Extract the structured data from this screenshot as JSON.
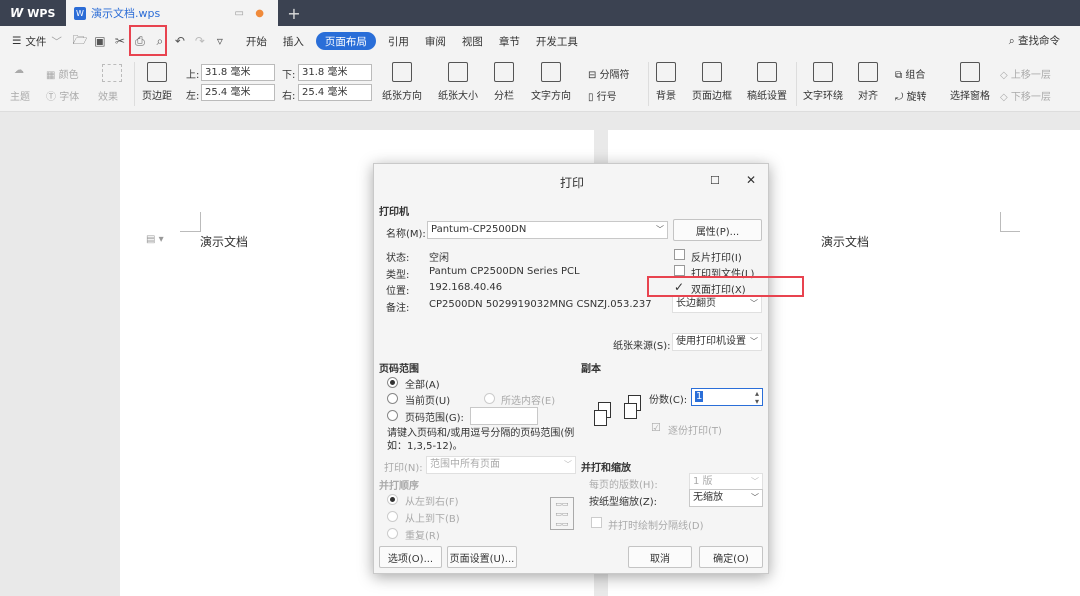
{
  "titlebar": {
    "wps_label": "WPS",
    "doc_tab": "演示文档.wps",
    "new_tab": "+"
  },
  "menubar": {
    "file": "文件",
    "items": [
      "开始",
      "插入",
      "页面布局",
      "引用",
      "审阅",
      "视图",
      "章节",
      "开发工具"
    ],
    "active": "页面布局",
    "search": "查找命令"
  },
  "ribbon": {
    "theme": "主题",
    "colors": "颜色",
    "fonts": "字体",
    "effects": "效果",
    "margins": "页边距",
    "top_label": "上:",
    "top_value": "31.8 毫米",
    "bottom_label": "下:",
    "bottom_value": "31.8 毫米",
    "left_label": "左:",
    "left_value": "25.4 毫米",
    "right_label": "右:",
    "right_value": "25.4 毫米",
    "orientation": "纸张方向",
    "size": "纸张大小",
    "columns": "分栏",
    "text_direction": "文字方向",
    "separator": "分隔符",
    "line_numbers": "行号",
    "background": "背景",
    "page_border": "页面边框",
    "grid_settings": "稿纸设置",
    "text_wrap": "文字环绕",
    "align": "对齐",
    "group": "组合",
    "rotate": "旋转",
    "selection_pane": "选择窗格",
    "bring_forward": "上移一层",
    "send_backward": "下移一层"
  },
  "document": {
    "heading_left": "演示文档",
    "heading_right": "演示文档"
  },
  "dialog": {
    "title": "打印",
    "printer_section": "打印机",
    "name_label": "名称(M):",
    "printer_name": "Pantum-CP2500DN",
    "properties_button": "属性(P)...",
    "status_label": "状态:",
    "status_value": "空闲",
    "type_label": "类型:",
    "type_value": "Pantum CP2500DN Series PCL",
    "location_label": "位置:",
    "location_value": "192.168.40.46",
    "comment_label": "备注:",
    "comment_value": "CP2500DN 5029919032MNG CSNZJ.053.237",
    "reverse_print": "反片打印(I)",
    "print_to_file": "打印到文件(L)",
    "duplex_print": "双面打印(X)",
    "duplex_mode": "长边翻页",
    "paper_source_label": "纸张来源(S):",
    "paper_source_value": "使用打印机设置",
    "page_range_section": "页码范围",
    "range_all": "全部(A)",
    "range_current": "当前页(U)",
    "range_selection": "所选内容(E)",
    "range_pages": "页码范围(G):",
    "range_hint": "请键入页码和/或用逗号分隔的页码范围(例如：1,3,5-12)。",
    "print_label": "打印(N):",
    "print_value": "范围中所有页面",
    "collate_order_section": "并打顺序",
    "order_ltr": "从左到右(F)",
    "order_ttb": "从上到下(B)",
    "order_repeat": "重复(R)",
    "copies_section": "副本",
    "copies_label": "份数(C):",
    "copies_value": "1",
    "collate": "逐份打印(T)",
    "scale_section": "并打和缩放",
    "pages_per_sheet_label": "每页的版数(H):",
    "pages_per_sheet_value": "1 版",
    "scale_to_paper_label": "按纸型缩放(Z):",
    "scale_to_paper_value": "无缩放",
    "draw_separator": "并打时绘制分隔线(D)",
    "options_button": "选项(O)...",
    "page_setup_button": "页面设置(U)...",
    "cancel_button": "取消",
    "ok_button": "确定(O)"
  },
  "colors": {
    "accent": "#2a6ed8",
    "highlight": "#e8434f",
    "titlebar": "#3b4251"
  }
}
